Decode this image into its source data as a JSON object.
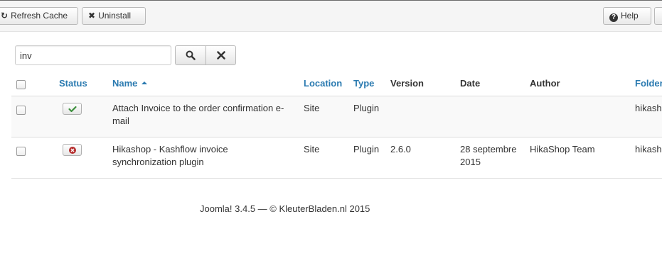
{
  "toolbar": {
    "refresh_label": "Refresh Cache",
    "uninstall_label": "Uninstall",
    "help_label": "Help"
  },
  "search": {
    "value": "inv"
  },
  "table": {
    "columns": {
      "status": "Status",
      "name": "Name",
      "location": "Location",
      "type": "Type",
      "version": "Version",
      "date": "Date",
      "author": "Author",
      "folder": "Folder"
    },
    "rows": [
      {
        "status": "enabled",
        "name_line1": "Attach Invoice to the order confirmation e-",
        "name_line2": "mail",
        "location": "Site",
        "type": "Plugin",
        "version": "",
        "date_line1": "",
        "date_line2": "",
        "author": "",
        "folder": "hikash"
      },
      {
        "status": "disabled",
        "name_line1": "Hikashop - Kashflow invoice",
        "name_line2": "synchronization plugin",
        "location": "Site",
        "type": "Plugin",
        "version": "2.6.0",
        "date_line1": "28 septembre",
        "date_line2": "2015",
        "author": "HikaShop Team",
        "folder": "hikash"
      }
    ]
  },
  "footer": {
    "text": "Joomla! 3.4.5  —  © KleuterBladen.nl 2015"
  },
  "colors": {
    "link": "#2a7ab0",
    "enabled": "#3c8f3c",
    "disabled": "#b52d2d"
  }
}
